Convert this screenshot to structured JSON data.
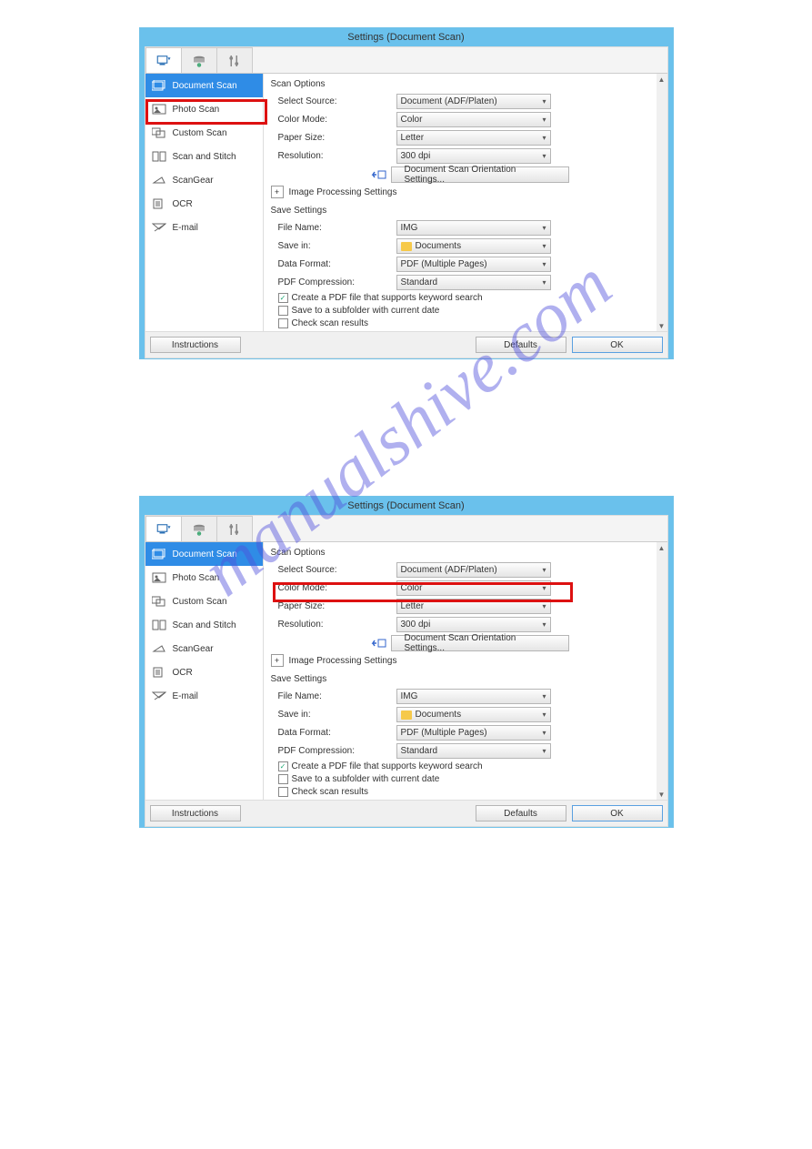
{
  "watermark": "manualshive.com",
  "window": {
    "title": "Settings (Document Scan)"
  },
  "sidebar": {
    "items": [
      {
        "label": "Document Scan"
      },
      {
        "label": "Photo Scan"
      },
      {
        "label": "Custom Scan"
      },
      {
        "label": "Scan and Stitch"
      },
      {
        "label": "ScanGear"
      },
      {
        "label": "OCR"
      },
      {
        "label": "E-mail"
      }
    ]
  },
  "scan": {
    "title": "Scan Options",
    "source_label": "Select Source:",
    "source_value": "Document (ADF/Platen)",
    "color_label": "Color Mode:",
    "color_value": "Color",
    "paper_label": "Paper Size:",
    "paper_value": "Letter",
    "res_label": "Resolution:",
    "res_value": "300 dpi",
    "orient_btn": "Document Scan Orientation Settings...",
    "img_proc": "Image Processing Settings"
  },
  "save": {
    "title": "Save Settings",
    "fname_label": "File Name:",
    "fname_value": "IMG",
    "savein_label": "Save in:",
    "savein_value": "Documents",
    "format_label": "Data Format:",
    "format_value": "PDF (Multiple Pages)",
    "comp_label": "PDF Compression:",
    "comp_value": "Standard",
    "ck_keyword": "Create a PDF file that supports keyword search",
    "ck_subfolder": "Save to a subfolder with current date",
    "ck_results": "Check scan results"
  },
  "footer": {
    "instructions": "Instructions",
    "defaults": "Defaults",
    "ok": "OK"
  }
}
